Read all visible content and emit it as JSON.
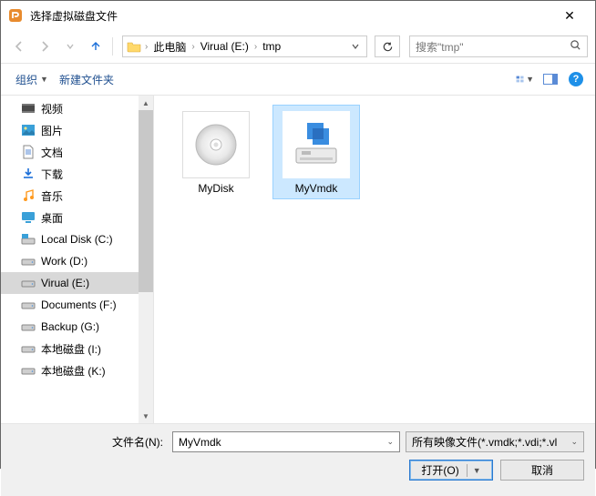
{
  "titlebar": {
    "title": "选择虚拟磁盘文件"
  },
  "nav": {
    "breadcrumb": [
      "此电脑",
      "Virual (E:)",
      "tmp"
    ],
    "search_placeholder": "搜索\"tmp\""
  },
  "toolbar": {
    "organize": "组织",
    "new_folder": "新建文件夹"
  },
  "tree": {
    "items": [
      {
        "label": "视频",
        "icon": "video"
      },
      {
        "label": "图片",
        "icon": "picture"
      },
      {
        "label": "文档",
        "icon": "document"
      },
      {
        "label": "下载",
        "icon": "download"
      },
      {
        "label": "音乐",
        "icon": "music"
      },
      {
        "label": "桌面",
        "icon": "desktop"
      },
      {
        "label": "Local Disk (C:)",
        "icon": "disk-win"
      },
      {
        "label": "Work (D:)",
        "icon": "disk"
      },
      {
        "label": "Virual (E:)",
        "icon": "disk",
        "selected": true
      },
      {
        "label": "Documents (F:)",
        "icon": "disk"
      },
      {
        "label": "Backup (G:)",
        "icon": "disk"
      },
      {
        "label": "本地磁盘 (I:)",
        "icon": "disk"
      },
      {
        "label": "本地磁盘 (K:)",
        "icon": "disk"
      }
    ]
  },
  "content": {
    "items": [
      {
        "label": "MyDisk",
        "icon": "disc",
        "selected": false
      },
      {
        "label": "MyVmdk",
        "icon": "vmdk",
        "selected": true
      }
    ]
  },
  "bottom": {
    "filename_label": "文件名(N):",
    "filename_value": "MyVmdk",
    "filter": "所有映像文件(*.vmdk;*.vdi;*.vl",
    "open": "打开(O)",
    "cancel": "取消"
  }
}
